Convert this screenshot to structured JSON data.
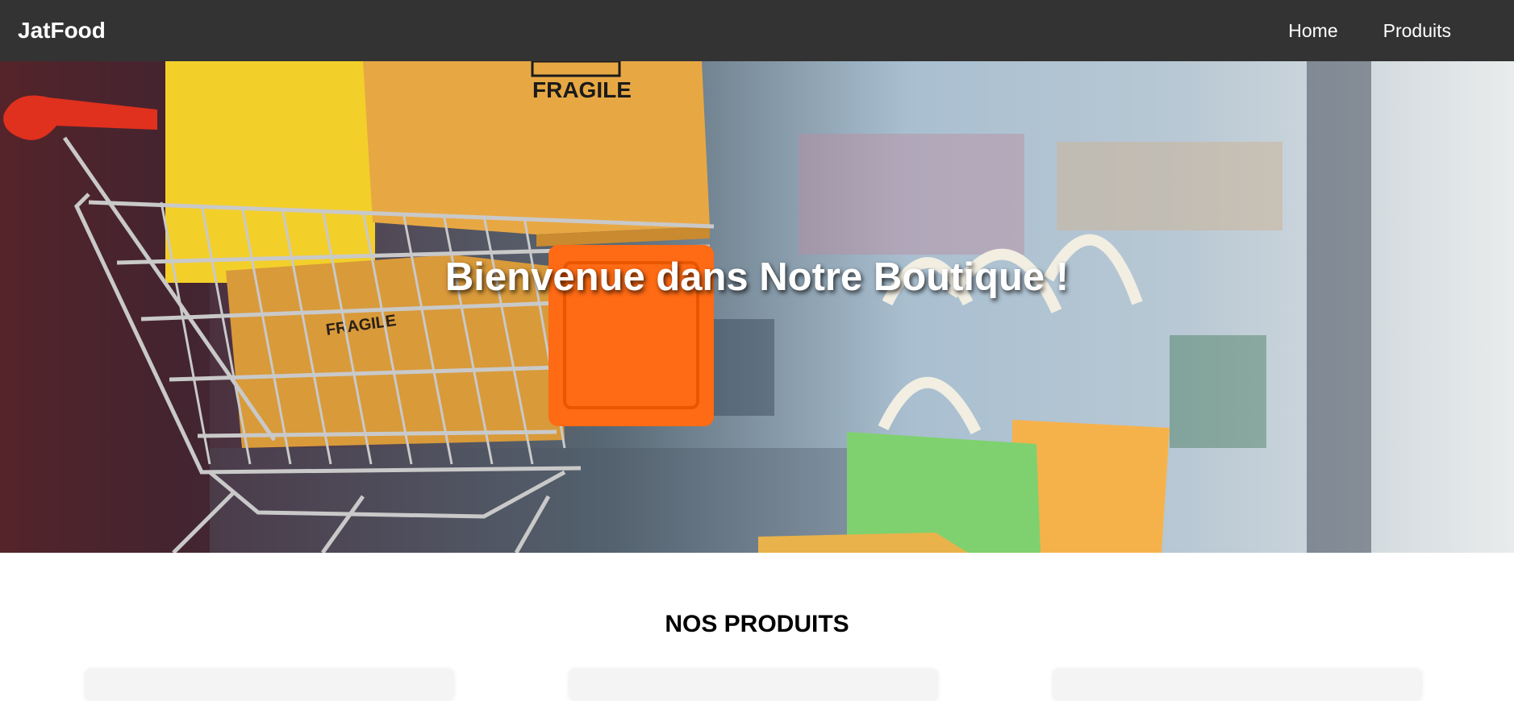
{
  "navbar": {
    "brand": "JatFood",
    "links": [
      {
        "label": "Home"
      },
      {
        "label": "Produits"
      }
    ]
  },
  "hero": {
    "title": "Bienvenue dans Notre Boutique !",
    "box_text_1": "FRAGILE",
    "box_text_2": "FRAGILE"
  },
  "products": {
    "title": "NOS PRODUITS"
  },
  "colors": {
    "navbar_bg": "#333333",
    "page_bg": "#ffffff",
    "cart_handle": "#e0301e",
    "box": "#e7a844",
    "box_yellow": "#f3cf2a",
    "orange_cap": "#ff6a14",
    "bag_green": "#7fd16f",
    "bag_orange": "#f6b24a"
  }
}
